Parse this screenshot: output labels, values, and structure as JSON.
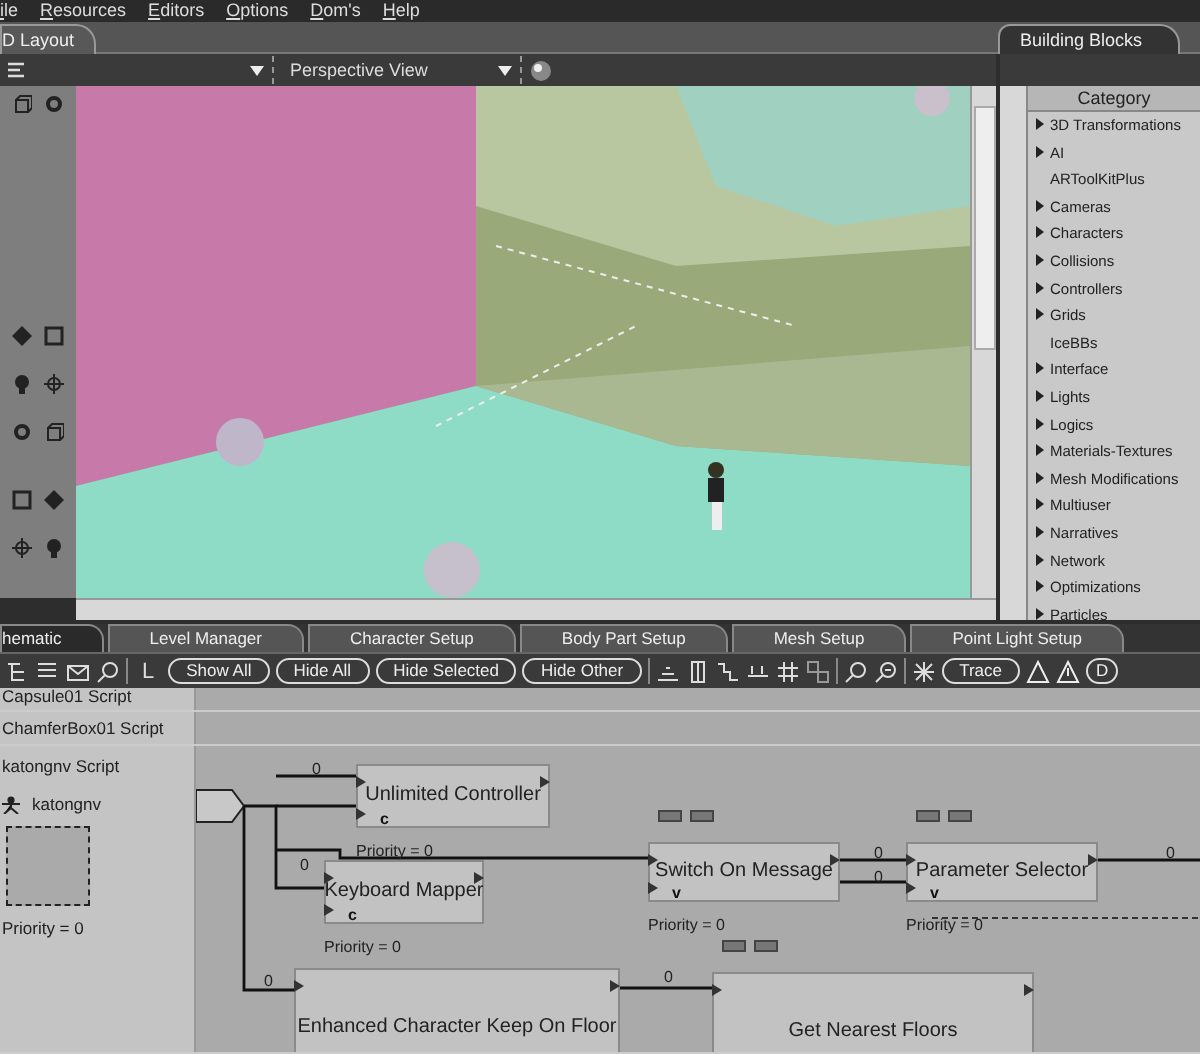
{
  "menu": [
    "ile",
    "Resources",
    "Editors",
    "Options",
    "Dom's",
    "Help"
  ],
  "layout_panel": {
    "tab": "D Layout",
    "camera_dropdown": "Perspective View"
  },
  "building_blocks": {
    "tab": "Building Blocks",
    "header": "Category",
    "items": [
      {
        "label": "3D Transformations",
        "expandable": true
      },
      {
        "label": "AI",
        "expandable": true
      },
      {
        "label": "ARToolKitPlus",
        "expandable": false
      },
      {
        "label": "Cameras",
        "expandable": true
      },
      {
        "label": "Characters",
        "expandable": true
      },
      {
        "label": "Collisions",
        "expandable": true
      },
      {
        "label": "Controllers",
        "expandable": true
      },
      {
        "label": "Grids",
        "expandable": true
      },
      {
        "label": "IceBBs",
        "expandable": false
      },
      {
        "label": "Interface",
        "expandable": true
      },
      {
        "label": "Lights",
        "expandable": true
      },
      {
        "label": "Logics",
        "expandable": true
      },
      {
        "label": "Materials-Textures",
        "expandable": true
      },
      {
        "label": "Mesh Modifications",
        "expandable": true
      },
      {
        "label": "Multiuser",
        "expandable": true
      },
      {
        "label": "Narratives",
        "expandable": true
      },
      {
        "label": "Network",
        "expandable": true
      },
      {
        "label": "Optimizations",
        "expandable": true
      },
      {
        "label": "Particles",
        "expandable": true
      }
    ]
  },
  "bottom_tabs": [
    {
      "label": "hematic",
      "selected": true
    },
    {
      "label": "Level Manager",
      "selected": false
    },
    {
      "label": "Character Setup",
      "selected": false
    },
    {
      "label": "Body Part Setup",
      "selected": false
    },
    {
      "label": "Mesh Setup",
      "selected": false
    },
    {
      "label": "Point Light Setup",
      "selected": false
    }
  ],
  "schematic_toolbar": {
    "view_letter": "L",
    "buttons": [
      "Show All",
      "Hide All",
      "Hide Selected",
      "Hide Other"
    ],
    "trace_button": "Trace",
    "cut_button": "D"
  },
  "scripts": [
    "Capsule01 Script",
    "ChamferBox01 Script",
    "katongnv Script"
  ],
  "script_owner": {
    "name": "katongnv",
    "priority": "Priority = 0"
  },
  "nodes": [
    {
      "title": "Unlimited Controller",
      "marker": "c",
      "priority": "Priority = 0"
    },
    {
      "title": "Keyboard Mapper",
      "marker": "c",
      "priority": "Priority = 0"
    },
    {
      "title": "Enhanced Character Keep On Floor"
    },
    {
      "title": "Switch On Message",
      "marker": "v",
      "priority": "Priority = 0"
    },
    {
      "title": "Parameter Selector",
      "marker": "v",
      "priority": "Priority = 0"
    },
    {
      "title": "Get Nearest Floors"
    }
  ],
  "link_labels": [
    "0",
    "0",
    "0",
    "0",
    "0",
    "0",
    "0"
  ]
}
